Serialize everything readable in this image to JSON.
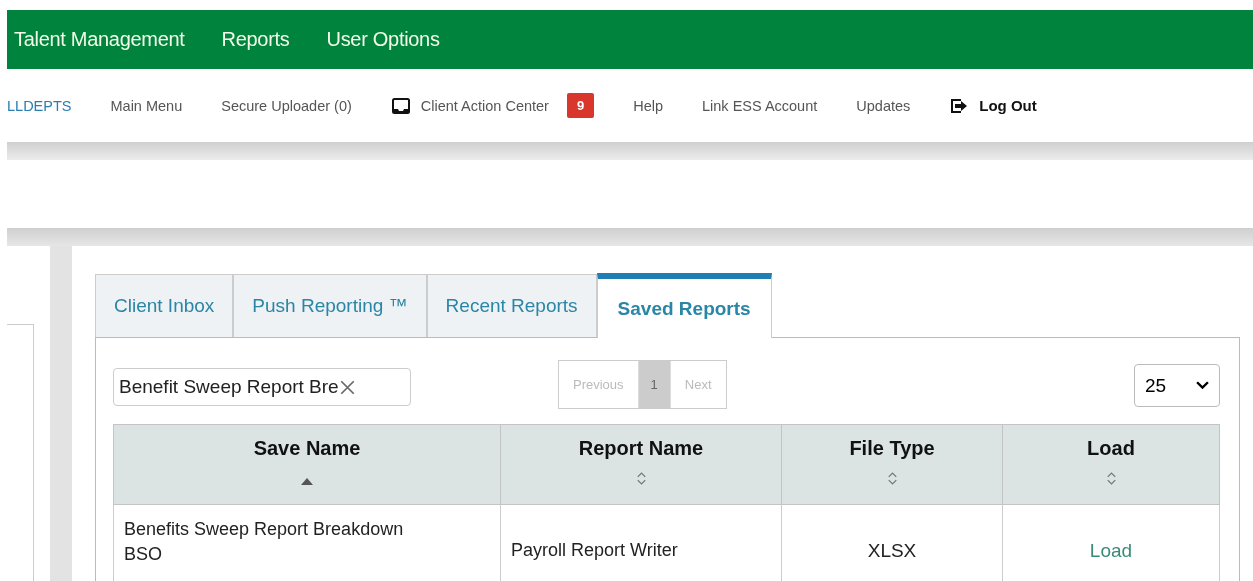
{
  "main_menu": [
    "Talent Management",
    "Reports",
    "User Options"
  ],
  "nav_links": [
    {
      "label": "LLDEPTS",
      "kind": "link",
      "selected": true
    },
    {
      "label": "Main Menu",
      "kind": "link",
      "selected": false
    },
    {
      "label": "Secure Uploader (0)",
      "kind": "link",
      "selected": false
    },
    {
      "label": "Client Action Center",
      "kind": "inbox",
      "selected": false,
      "badge": "9"
    },
    {
      "label": "Help",
      "kind": "link",
      "selected": false
    },
    {
      "label": "Link ESS Account",
      "kind": "link",
      "selected": false
    },
    {
      "label": "Updates",
      "kind": "link",
      "selected": false
    },
    {
      "label": "Log Out",
      "kind": "logout",
      "selected": false
    }
  ],
  "tabs": [
    {
      "label": "Client Inbox",
      "selected": false
    },
    {
      "label": "Push Reporting ™",
      "selected": false
    },
    {
      "label": "Recent Reports",
      "selected": false
    },
    {
      "label": "Saved Reports",
      "selected": true
    }
  ],
  "search": {
    "value": "Benefit Sweep Report Bre"
  },
  "pagination": [
    {
      "label": "Previous",
      "selected": false,
      "disabled": true
    },
    {
      "label": "1",
      "selected": true,
      "disabled": false
    },
    {
      "label": "Next",
      "selected": false,
      "disabled": true
    }
  ],
  "page_size": "25",
  "table": {
    "columns": [
      {
        "label": "Save Name",
        "sorted": true
      },
      {
        "label": "Report Name",
        "sorted": false
      },
      {
        "label": "File Type",
        "sorted": false
      },
      {
        "label": "Load",
        "sorted": false
      }
    ],
    "rows": [
      {
        "save_name": "Benefits Sweep Report Breakdown BSO",
        "report_name": "Payroll Report Writer",
        "file_type": "XLSX",
        "load": "Load"
      }
    ]
  }
}
